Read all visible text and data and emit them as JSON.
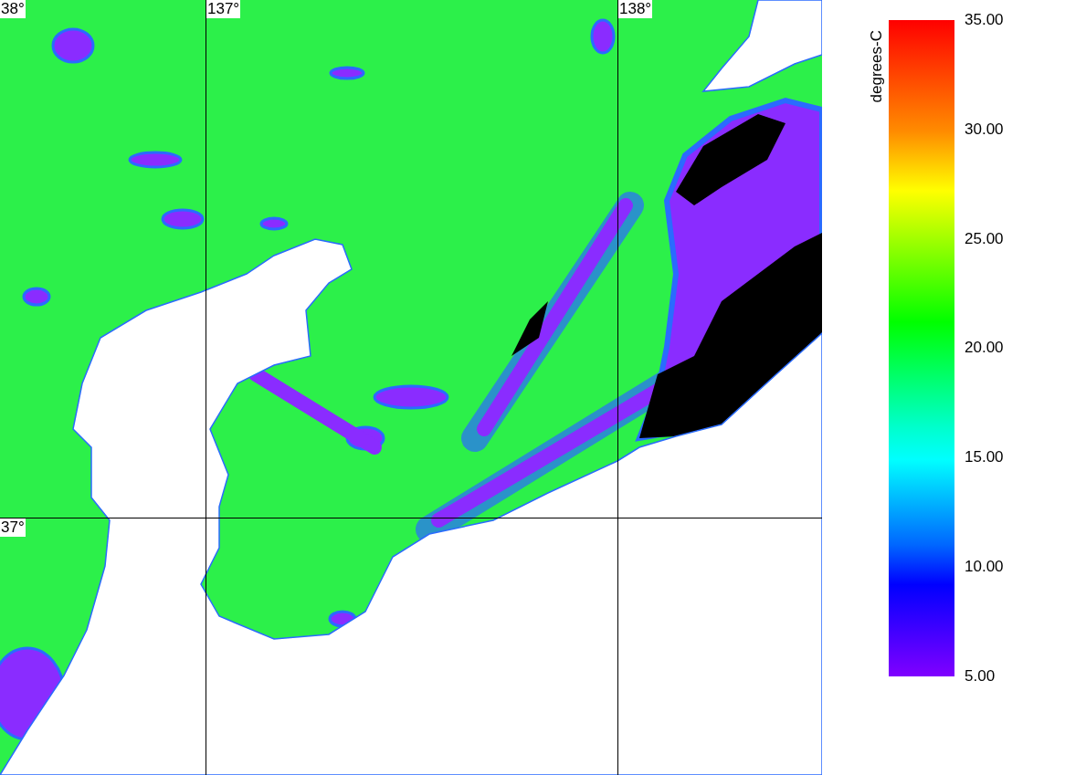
{
  "map": {
    "lat_labels": [
      "38°",
      "37°"
    ],
    "lon_labels": [
      "137°",
      "138°"
    ]
  },
  "colorbar": {
    "unit": "degrees-C",
    "ticks": [
      "35.00",
      "30.00",
      "25.00",
      "20.00",
      "15.00",
      "10.00",
      "5.00"
    ]
  }
}
